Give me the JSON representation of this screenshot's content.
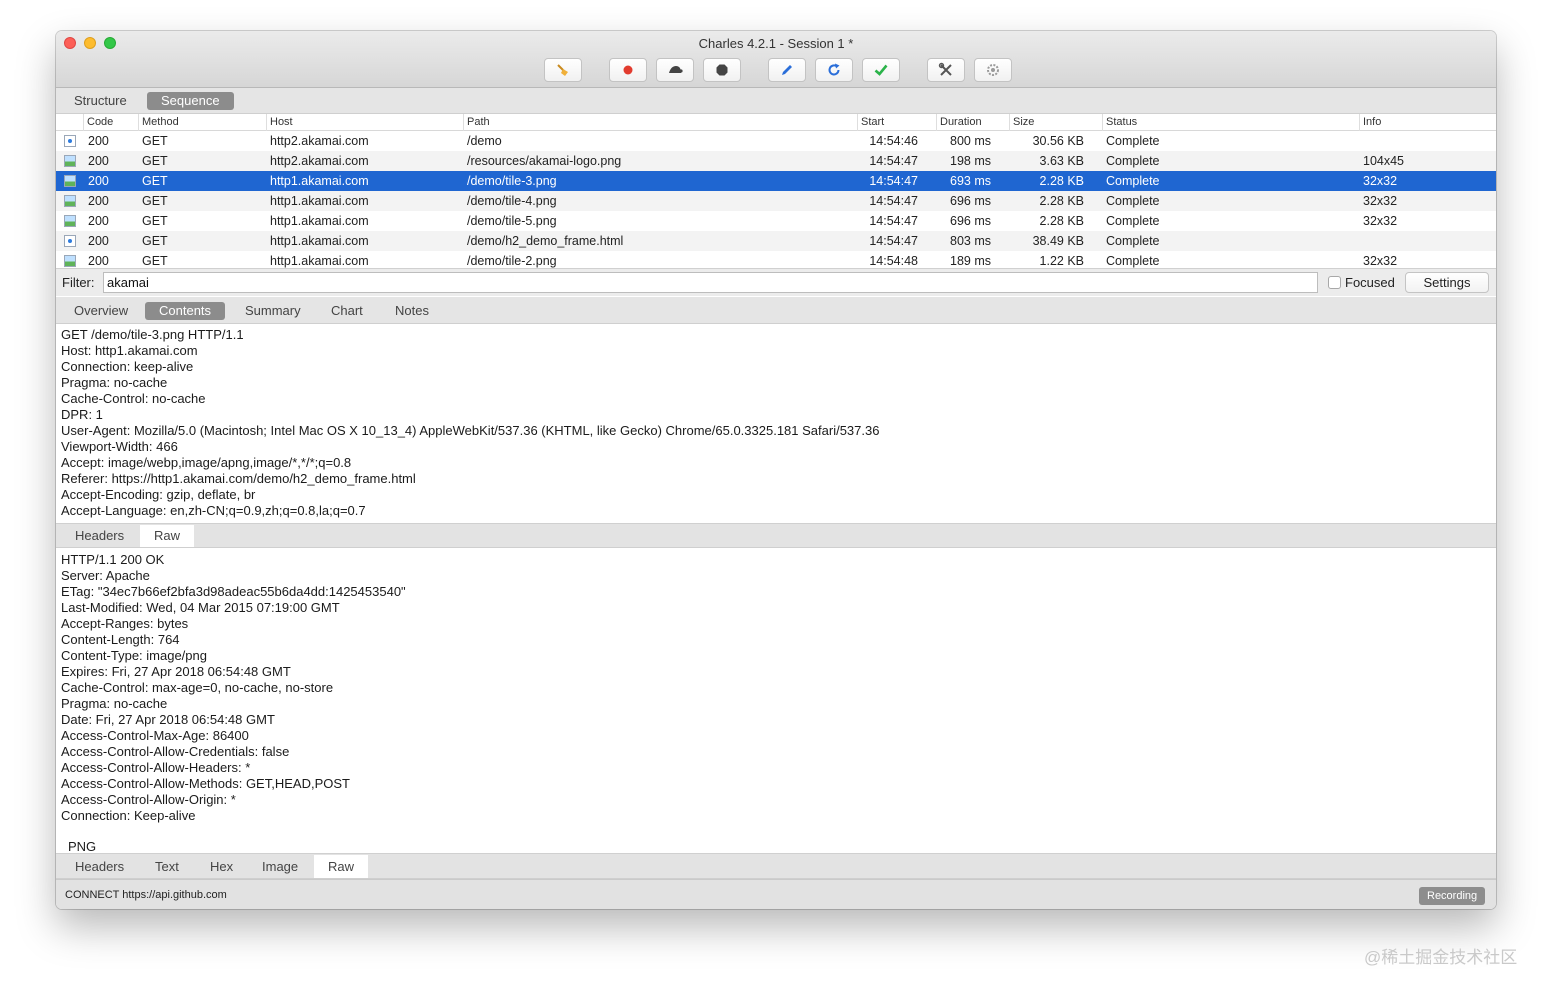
{
  "window": {
    "title": "Charles 4.2.1 - Session 1 *"
  },
  "toolbar": [
    {
      "name": "broom-icon",
      "color": "#e6a23c"
    },
    {
      "name": "record-icon",
      "color": "#e23b2e"
    },
    {
      "name": "turtle-icon",
      "color": "#444444"
    },
    {
      "name": "breakpoint-icon",
      "color": "#444444"
    },
    {
      "name": "pen-icon",
      "color": "#2a6ed9"
    },
    {
      "name": "refresh-icon",
      "color": "#2a6ed9"
    },
    {
      "name": "check-icon",
      "color": "#2bb34a"
    },
    {
      "name": "tools-icon",
      "color": "#555555"
    },
    {
      "name": "gear-icon",
      "color": "#9a9a9a"
    }
  ],
  "view_tabs": {
    "structure": "Structure",
    "sequence": "Sequence"
  },
  "table": {
    "columns": [
      "Code",
      "Method",
      "Host",
      "Path",
      "Start",
      "Duration",
      "Size",
      "Status",
      "Info"
    ],
    "rows": [
      {
        "icon": "doc",
        "code": "200",
        "method": "GET",
        "host": "http2.akamai.com",
        "path": "/demo",
        "start": "14:54:46",
        "duration": "800 ms",
        "size": "30.56 KB",
        "status": "Complete",
        "info": ""
      },
      {
        "icon": "img",
        "code": "200",
        "method": "GET",
        "host": "http2.akamai.com",
        "path": "/resources/akamai-logo.png",
        "start": "14:54:47",
        "duration": "198 ms",
        "size": "3.63 KB",
        "status": "Complete",
        "info": "104x45"
      },
      {
        "icon": "img",
        "code": "200",
        "method": "GET",
        "host": "http1.akamai.com",
        "path": "/demo/tile-3.png",
        "start": "14:54:47",
        "duration": "693 ms",
        "size": "2.28 KB",
        "status": "Complete",
        "info": "32x32",
        "selected": true
      },
      {
        "icon": "img",
        "code": "200",
        "method": "GET",
        "host": "http1.akamai.com",
        "path": "/demo/tile-4.png",
        "start": "14:54:47",
        "duration": "696 ms",
        "size": "2.28 KB",
        "status": "Complete",
        "info": "32x32"
      },
      {
        "icon": "img",
        "code": "200",
        "method": "GET",
        "host": "http1.akamai.com",
        "path": "/demo/tile-5.png",
        "start": "14:54:47",
        "duration": "696 ms",
        "size": "2.28 KB",
        "status": "Complete",
        "info": "32x32"
      },
      {
        "icon": "doc",
        "code": "200",
        "method": "GET",
        "host": "http1.akamai.com",
        "path": "/demo/h2_demo_frame.html",
        "start": "14:54:47",
        "duration": "803 ms",
        "size": "38.49 KB",
        "status": "Complete",
        "info": ""
      },
      {
        "icon": "img",
        "code": "200",
        "method": "GET",
        "host": "http1.akamai.com",
        "path": "/demo/tile-2.png",
        "start": "14:54:48",
        "duration": "189 ms",
        "size": "1.22 KB",
        "status": "Complete",
        "info": "32x32"
      }
    ]
  },
  "filter": {
    "label": "Filter:",
    "value": "akamai",
    "focused_label": "Focused",
    "settings_label": "Settings"
  },
  "detail_tabs": {
    "overview": "Overview",
    "contents": "Contents",
    "summary": "Summary",
    "chart": "Chart",
    "notes": "Notes"
  },
  "request_text": "GET /demo/tile-3.png HTTP/1.1\nHost: http1.akamai.com\nConnection: keep-alive\nPragma: no-cache\nCache-Control: no-cache\nDPR: 1\nUser-Agent: Mozilla/5.0 (Macintosh; Intel Mac OS X 10_13_4) AppleWebKit/537.36 (KHTML, like Gecko) Chrome/65.0.3325.181 Safari/537.36\nViewport-Width: 466\nAccept: image/webp,image/apng,image/*,*/*;q=0.8\nReferer: https://http1.akamai.com/demo/h2_demo_frame.html\nAccept-Encoding: gzip, deflate, br\nAccept-Language: en,zh-CN;q=0.9,zh;q=0.8,la;q=0.7",
  "request_tabs": {
    "headers": "Headers",
    "raw": "Raw"
  },
  "response_text": "HTTP/1.1 200 OK\nServer: Apache\nETag: \"34ec7b66ef2bfa3d98adeac55b6da4dd:1425453540\"\nLast-Modified: Wed, 04 Mar 2015 07:19:00 GMT\nAccept-Ranges: bytes\nContent-Length: 764\nContent-Type: image/png\nExpires: Fri, 27 Apr 2018 06:54:48 GMT\nCache-Control: max-age=0, no-cache, no-store\nPragma: no-cache\nDate: Fri, 27 Apr 2018 06:54:48 GMT\nAccess-Control-Max-Age: 86400\nAccess-Control-Allow-Credentials: false\nAccess-Control-Allow-Headers: *\nAccess-Control-Allow-Methods: GET,HEAD,POST\nAccess-Control-Allow-Origin: *\nConnection: Keep-alive",
  "png_label": "PNG",
  "response_tabs": {
    "headers": "Headers",
    "text": "Text",
    "hex": "Hex",
    "image": "Image",
    "raw": "Raw"
  },
  "statusbar": {
    "text": "CONNECT https://api.github.com",
    "recording": "Recording"
  },
  "watermark": "@稀土掘金技术社区"
}
